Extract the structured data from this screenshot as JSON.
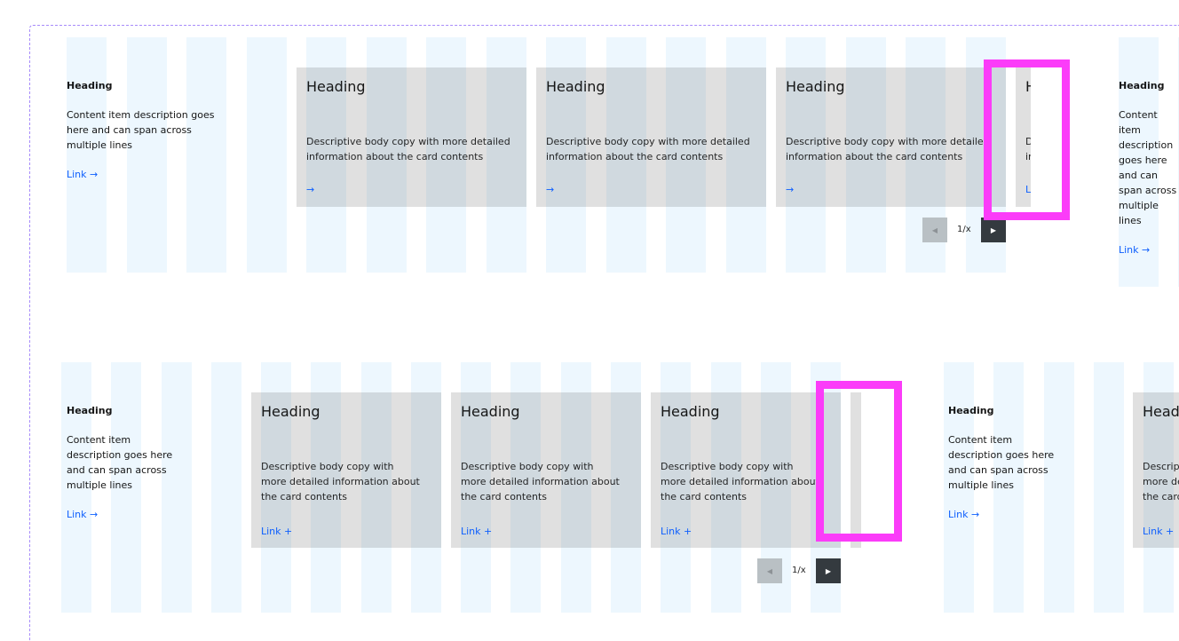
{
  "top": {
    "items": [
      {
        "heading": "Heading",
        "description": "Content item description goes here and can span across multiple lines",
        "link": "Link →"
      },
      {
        "heading": "Heading",
        "description": "Content item description goes here and can span across multiple lines",
        "link": "Link →"
      }
    ],
    "cards": [
      {
        "heading": "Heading",
        "body": "Descriptive body copy with more detailed information about the card contents",
        "link": "→"
      },
      {
        "heading": "Heading",
        "body": "Descriptive body copy with more detailed information about the card contents",
        "link": "→"
      },
      {
        "heading": "Heading",
        "body": "Descriptive body copy with more detailed information about the card contents",
        "link": "→"
      },
      {
        "heading": "Heading",
        "body": "Descriptive body copy with more detailed information about the card contents",
        "link": "Link"
      }
    ],
    "pagination": {
      "prev": "◀",
      "count": "1/x",
      "next": "▶"
    }
  },
  "bottom": {
    "items": [
      {
        "heading": "Heading",
        "description": "Content item description goes here and can span across multiple lines",
        "link": "Link →"
      },
      {
        "heading": "Heading",
        "description": "Content item description goes here and can span across multiple lines",
        "link": "Link →"
      }
    ],
    "cards": [
      {
        "heading": "Heading",
        "body": "Descriptive body copy with more detailed information about the card contents",
        "link": "Link  +"
      },
      {
        "heading": "Heading",
        "body": "Descriptive body copy with more detailed information about the card contents",
        "link": "Link  +"
      },
      {
        "heading": "Heading",
        "body": "Descriptive body copy with more detailed information about the card contents",
        "link": "Link  +"
      },
      {
        "heading": "",
        "body": "",
        "link": ""
      },
      {
        "heading": "Heading",
        "body": "Descriptive body copy with more detailed information about the card contents",
        "link": "Link  +"
      }
    ],
    "pagination": {
      "prev": "◀",
      "count": "1/x",
      "next": "▶"
    }
  },
  "colors": {
    "highlight": "#fb3cf9",
    "link": "#0f62fe",
    "grid": "#edf7fe",
    "card": "#e0e0e0"
  }
}
